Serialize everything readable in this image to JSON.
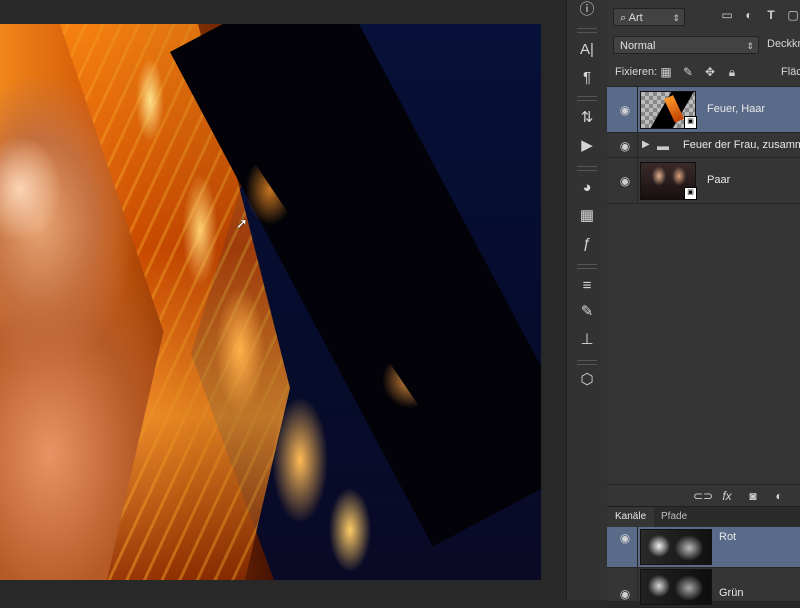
{
  "layers": {
    "filter_kind": "Art",
    "blend_mode": "Normal",
    "opacity_label": "Deckkra",
    "lock_label": "Fixieren:",
    "fill_label": "Fläc",
    "items": [
      {
        "name": "Feuer, Haar",
        "type": "smart-object",
        "selected": true
      },
      {
        "name": "Feuer der Frau, zusammen",
        "type": "group",
        "selected": false
      },
      {
        "name": "Paar",
        "type": "smart-object",
        "selected": false
      }
    ],
    "footer_icons": [
      "link-icon",
      "fx-icon",
      "mask-icon",
      "adjustment-icon"
    ]
  },
  "channels": {
    "tabs": [
      "Kanäle",
      "Pfade"
    ],
    "items": [
      {
        "name": "Rot",
        "selected": true
      },
      {
        "name": "Grün",
        "selected": false
      }
    ]
  },
  "tool_strip_icons": [
    "info-icon",
    "character-icon",
    "paragraph-icon",
    "history-icon",
    "actions-icon",
    "color-swatches-icon",
    "layer-comps-icon",
    "styles-icon",
    "adjustments-icon",
    "brushes-icon",
    "clone-source-icon",
    "3d-icon"
  ],
  "colors": {
    "selected_row": "#5a6b8a",
    "panel_bg": "#353535",
    "canvas_bg": "#282828"
  }
}
